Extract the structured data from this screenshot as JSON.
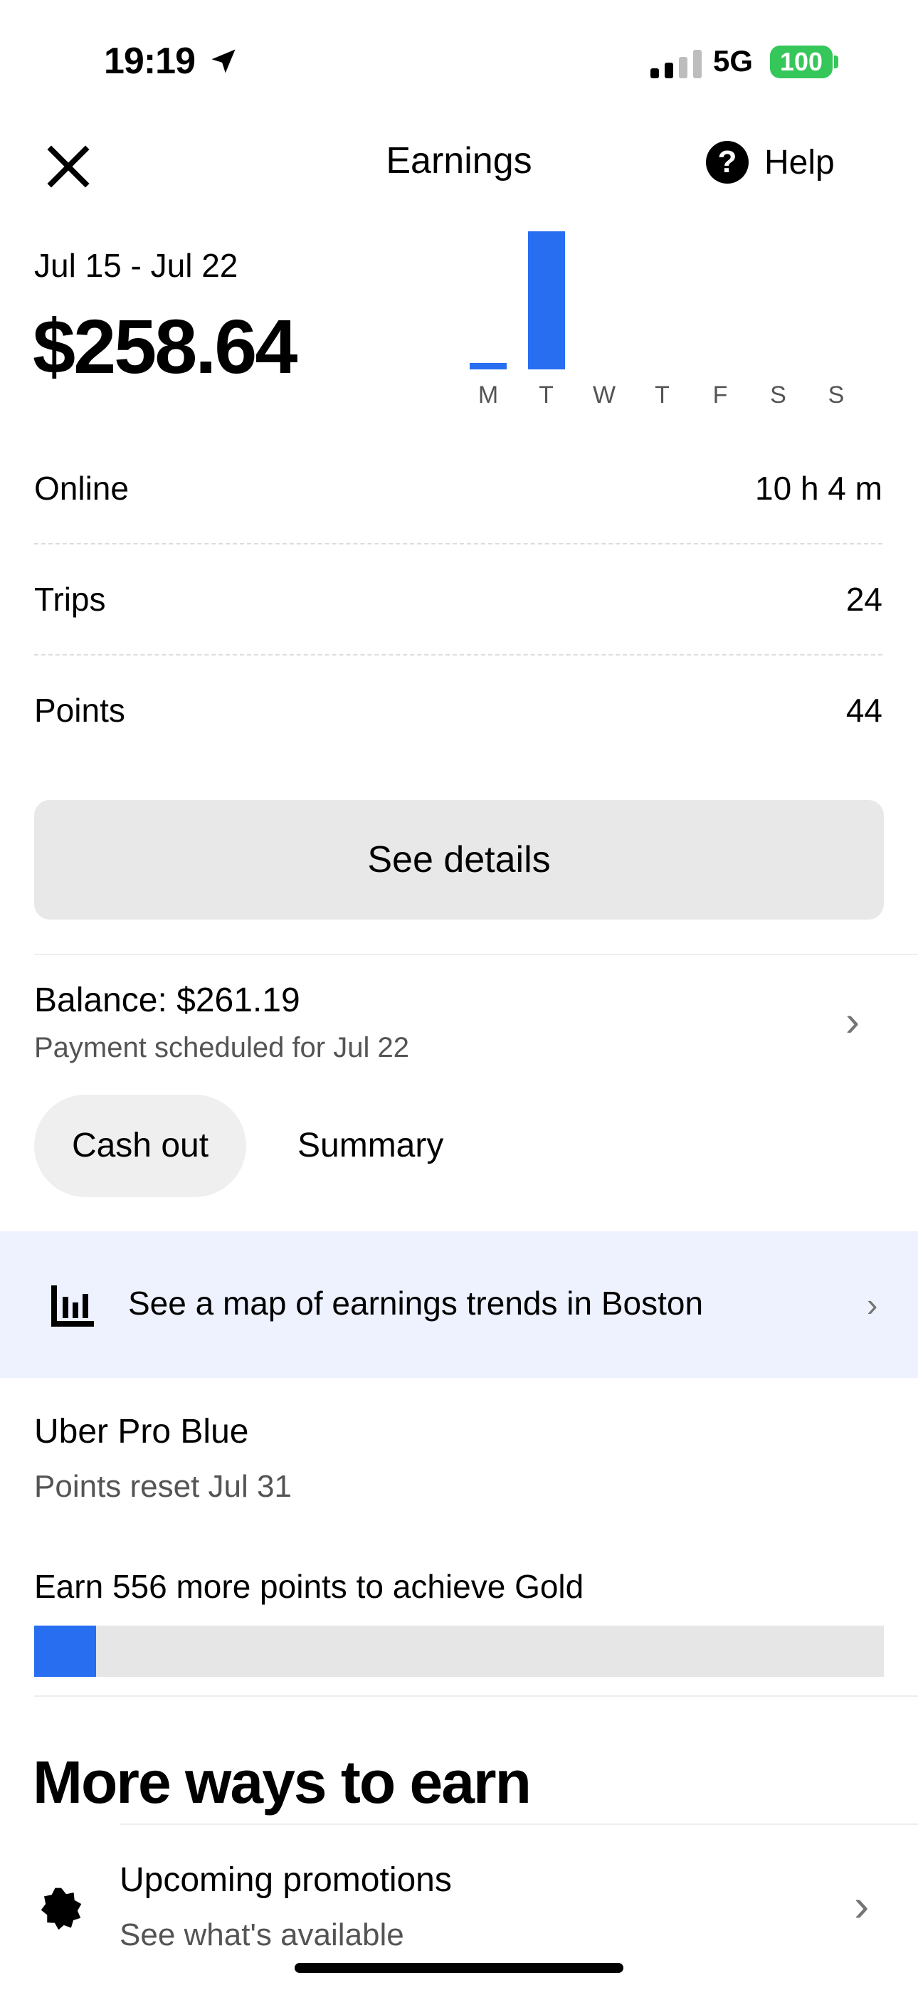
{
  "status_bar": {
    "time": "19:19",
    "network": "5G",
    "battery": "100"
  },
  "header": {
    "title": "Earnings",
    "help_label": "Help"
  },
  "summary": {
    "date_range": "Jul 15 - Jul 22",
    "total": "$258.64"
  },
  "chart_data": {
    "type": "bar",
    "categories": [
      "M",
      "T",
      "W",
      "T",
      "F",
      "S",
      "S"
    ],
    "values": [
      12.0,
      246.64,
      0,
      0,
      0,
      0,
      0
    ],
    "colors": {
      "bar": "#276ef1"
    }
  },
  "stats": [
    {
      "label": "Online",
      "value": "10 h 4 m"
    },
    {
      "label": "Trips",
      "value": "24"
    },
    {
      "label": "Points",
      "value": "44"
    }
  ],
  "details_button": "See details",
  "balance": {
    "label": "Balance: $261.19",
    "schedule": "Payment scheduled for Jul 22"
  },
  "actions": {
    "cash_out": "Cash out",
    "summary": "Summary"
  },
  "map_banner": {
    "text": "See a map of earnings trends in Boston",
    "icon": "bar-chart-icon"
  },
  "uber_pro": {
    "tier": "Uber Pro Blue",
    "reset": "Points reset Jul 31",
    "goal_text": "Earn 556 more points to achieve Gold",
    "progress": 0.073
  },
  "more_ways": {
    "title": "More ways to earn",
    "items": [
      {
        "title": "Upcoming promotions",
        "subtitle": "See what's available",
        "icon": "promotion-badge-icon"
      }
    ]
  },
  "colors": {
    "accent": "#276ef1",
    "battery": "#35c759",
    "banner": "#eef2fe"
  }
}
